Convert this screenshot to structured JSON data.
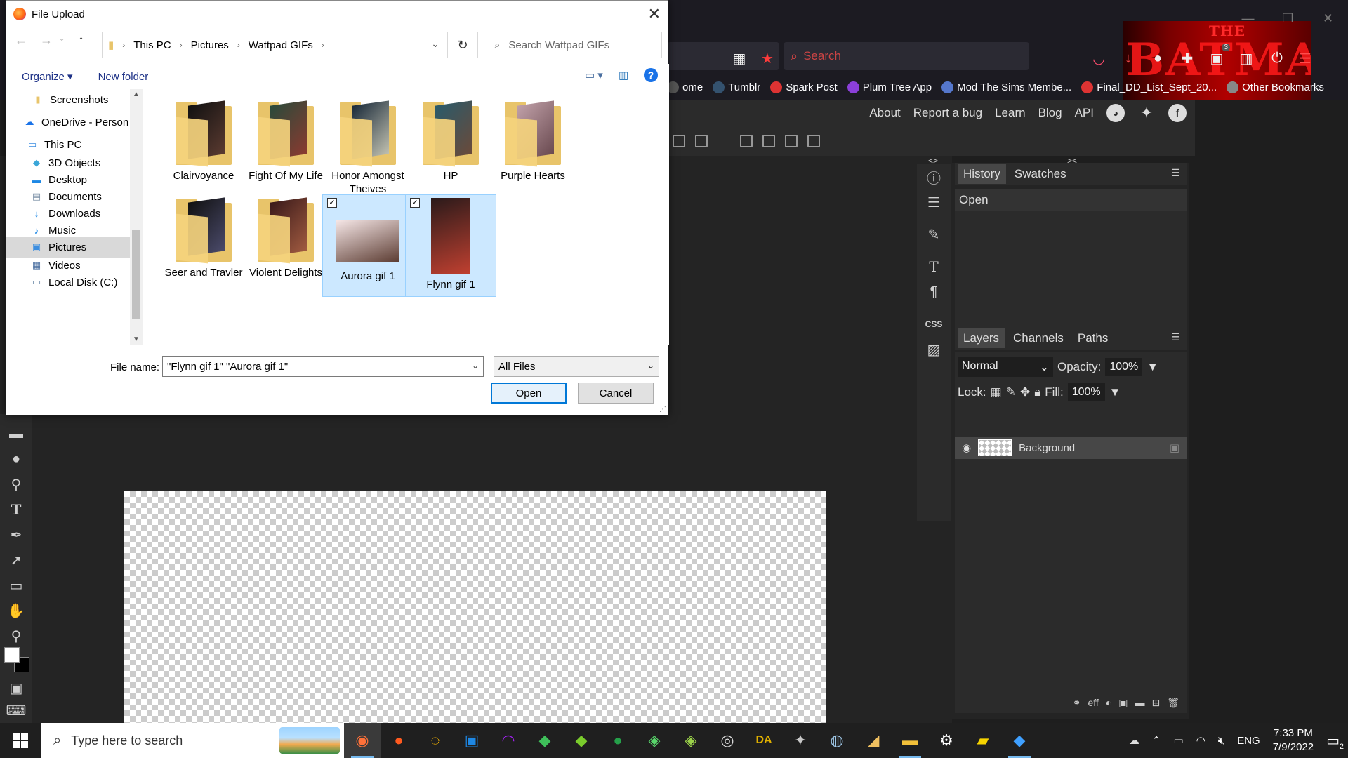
{
  "browser": {
    "search_placeholder": "Search",
    "banner_small": "THE",
    "banner_title": "BATMAN",
    "pocket_badge": "3",
    "bookmarks": [
      {
        "label": "ome",
        "icon": "home-icon",
        "color": "#555"
      },
      {
        "label": "Tumblr",
        "icon": "tumblr-icon",
        "color": "#34526f"
      },
      {
        "label": "Spark Post",
        "icon": "globe-icon",
        "color": "#d33"
      },
      {
        "label": "Plum Tree App",
        "icon": "plum-icon",
        "color": "#8b3fd9"
      },
      {
        "label": "Mod The Sims Membe...",
        "icon": "image-icon",
        "color": "#5577cc"
      },
      {
        "label": "Final_DD_List_Sept_20...",
        "icon": "globe-icon",
        "color": "#d33"
      },
      {
        "label": "Other Bookmarks",
        "icon": "folder-icon",
        "color": "#888"
      }
    ]
  },
  "photopea": {
    "header_links": [
      "About",
      "Report a bug",
      "Learn",
      "Blog",
      "API"
    ],
    "history_tabs": [
      "History",
      "Swatches"
    ],
    "history_items": [
      "Open"
    ],
    "layer_tabs": [
      "Layers",
      "Channels",
      "Paths"
    ],
    "blend_mode": "Normal",
    "opacity_label": "Opacity:",
    "opacity_value": "100%",
    "lock_label": "Lock:",
    "fill_label": "Fill:",
    "fill_value": "100%",
    "layer_name": "Background",
    "side_css_label": "CSS",
    "footer_icons": [
      "link-icon",
      "effects-icon",
      "adjustment-icon",
      "mask-icon",
      "folder-icon",
      "new-layer-icon",
      "trash-icon"
    ]
  },
  "dialog": {
    "title": "File Upload",
    "breadcrumb": [
      "This PC",
      "Pictures",
      "Wattpad GIFs"
    ],
    "search_placeholder": "Search Wattpad GIFs",
    "organize_label": "Organize ▾",
    "new_folder_label": "New folder",
    "nav_items": [
      {
        "label": "Screenshots",
        "icon": "folder-icon",
        "glyph": "▮",
        "color": "#e8c46a",
        "selected": false
      },
      {
        "label": "OneDrive - Person",
        "icon": "cloud-icon",
        "glyph": "☁",
        "color": "#1a73e8",
        "selected": false
      },
      {
        "label": "This PC",
        "icon": "computer-icon",
        "glyph": "▭",
        "color": "#3c8ee0",
        "selected": false
      },
      {
        "label": "3D Objects",
        "icon": "cube-icon",
        "glyph": "◆",
        "color": "#3aa6d8",
        "selected": false
      },
      {
        "label": "Desktop",
        "icon": "desktop-icon",
        "glyph": "▬",
        "color": "#1e88e5",
        "selected": false
      },
      {
        "label": "Documents",
        "icon": "document-icon",
        "glyph": "▤",
        "color": "#7a8fa6",
        "selected": false
      },
      {
        "label": "Downloads",
        "icon": "download-icon",
        "glyph": "↓",
        "color": "#1e88e5",
        "selected": false
      },
      {
        "label": "Music",
        "icon": "music-icon",
        "glyph": "♪",
        "color": "#1e88e5",
        "selected": false
      },
      {
        "label": "Pictures",
        "icon": "pictures-icon",
        "glyph": "▣",
        "color": "#3c8ee0",
        "selected": true
      },
      {
        "label": "Videos",
        "icon": "video-icon",
        "glyph": "▦",
        "color": "#4a6fa0",
        "selected": false
      },
      {
        "label": "Local Disk (C:)",
        "icon": "disk-icon",
        "glyph": "▭",
        "color": "#5f7fa0",
        "selected": false
      }
    ],
    "files": [
      {
        "name": "Clairvoyance",
        "kind": "folder",
        "colors": [
          "#111",
          "#5a3a30"
        ],
        "selected": false
      },
      {
        "name": "Fight Of My Life",
        "kind": "folder",
        "colors": [
          "#2a4a3a",
          "#8a3a30"
        ],
        "selected": false
      },
      {
        "name": "Honor Amongst Theives",
        "kind": "folder",
        "colors": [
          "#1a2a3a",
          "#c0c0b0"
        ],
        "selected": false
      },
      {
        "name": "HP",
        "kind": "folder",
        "colors": [
          "#2a5a6a",
          "#6a4a3a"
        ],
        "selected": false
      },
      {
        "name": "Purple Hearts",
        "kind": "folder",
        "colors": [
          "#c0a0a8",
          "#6a4a50"
        ],
        "selected": false
      },
      {
        "name": "Seer and Travler",
        "kind": "folder",
        "colors": [
          "#111",
          "#4a4a6a"
        ],
        "selected": false
      },
      {
        "name": "Violent Delights",
        "kind": "folder",
        "colors": [
          "#3a1a1a",
          "#a05a40"
        ],
        "selected": false
      },
      {
        "name": "Aurora gif 1",
        "kind": "image",
        "colors": [
          "#f5e6e6",
          "#5a3a30"
        ],
        "selected": true
      },
      {
        "name": "Flynn gif 1",
        "kind": "image-tall",
        "colors": [
          "#2a1a1a",
          "#c04030"
        ],
        "selected": true
      }
    ],
    "file_name_label": "File name:",
    "file_name_value": "\"Flynn gif 1\" \"Aurora gif 1\"",
    "file_type_value": "All Files",
    "open_label": "Open",
    "cancel_label": "Cancel"
  },
  "taskbar": {
    "search_placeholder": "Type here to search",
    "apps": [
      {
        "icon": "firefox-icon",
        "glyph": "◉",
        "color": "#ff7139",
        "active": true,
        "focus": true
      },
      {
        "icon": "firefox-alt-icon",
        "glyph": "●",
        "color": "#ff5a1f",
        "active": false,
        "focus": false
      },
      {
        "icon": "spiral-app-icon",
        "glyph": "◌",
        "color": "#f7b500",
        "active": false,
        "focus": false
      },
      {
        "icon": "window-app-icon",
        "glyph": "▣",
        "color": "#1e88e5",
        "active": false,
        "focus": false
      },
      {
        "icon": "headset-app-icon",
        "glyph": "◠",
        "color": "#a020f0",
        "active": false,
        "focus": false
      },
      {
        "icon": "sims-diamond-icon",
        "glyph": "◆",
        "color": "#3fbf5a",
        "active": false,
        "focus": false
      },
      {
        "icon": "sims-green-icon",
        "glyph": "◆",
        "color": "#7acc2c",
        "active": false,
        "focus": false
      },
      {
        "icon": "sims-globe-icon",
        "glyph": "●",
        "color": "#25a04a",
        "active": false,
        "focus": false
      },
      {
        "icon": "sims-plumbob-icon",
        "glyph": "◈",
        "color": "#59d66b",
        "active": false,
        "focus": false
      },
      {
        "icon": "sims-leaf-icon",
        "glyph": "◈",
        "color": "#9bd24a",
        "active": false,
        "focus": false
      },
      {
        "icon": "aperture-icon",
        "glyph": "◎",
        "color": "#dddddd",
        "active": false,
        "focus": false
      },
      {
        "icon": "da-icon",
        "glyph": "DA",
        "color": "#e0b000",
        "active": false,
        "focus": false
      },
      {
        "icon": "game-character-icon",
        "glyph": "✦",
        "color": "#c8c8c8",
        "active": false,
        "focus": false
      },
      {
        "icon": "steam-icon",
        "glyph": "◍",
        "color": "#9ec6e6",
        "active": false,
        "focus": false
      },
      {
        "icon": "wing-app-icon",
        "glyph": "◢",
        "color": "#f0c060",
        "active": false,
        "focus": false
      },
      {
        "icon": "file-explorer-icon",
        "glyph": "▬",
        "color": "#f3c13a",
        "active": true,
        "focus": false
      },
      {
        "icon": "settings-icon",
        "glyph": "⚙",
        "color": "#ffffff",
        "active": false,
        "focus": false
      },
      {
        "icon": "sticky-notes-icon",
        "glyph": "▰",
        "color": "#f7d400",
        "active": false,
        "focus": false
      },
      {
        "icon": "photopea-drop-icon",
        "glyph": "◆",
        "color": "#3fa0ff",
        "active": true,
        "focus": false
      }
    ],
    "language": "ENG",
    "time": "7:33 PM",
    "date": "7/9/2022",
    "notification_count": "2"
  }
}
